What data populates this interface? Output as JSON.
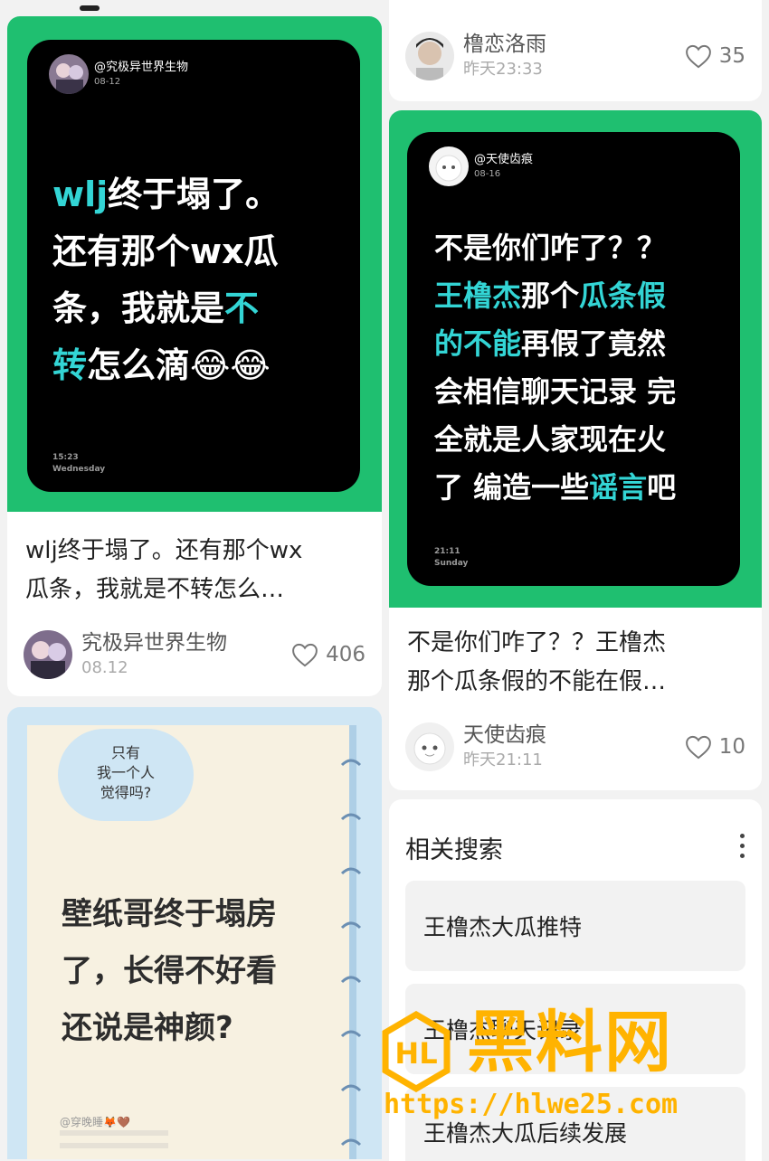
{
  "colors": {
    "green": "#1fbf70",
    "cyan": "#33d5d5",
    "watermark": "#ffb300"
  },
  "left_post_1": {
    "image": {
      "handle": "@究极异世界生物",
      "date": "08-12",
      "line1_cyan": "wlj",
      "line1": "终于塌了。",
      "line2": "还有那个wx瓜",
      "line3": "条，我就是",
      "line3_cyan": "不",
      "line4_cyan": "转",
      "line4": "怎么滴😂😂",
      "time": "15:23",
      "weekday": "Wednesday"
    },
    "title_line1": "wlj终于塌了。还有那个wx",
    "title_line2": "瓜条，我就是不转怎么…",
    "author": "究极异世界生物",
    "date": "08.12",
    "likes": "406"
  },
  "left_post_2": {
    "bubble_line1": "只有",
    "bubble_line2": "我一个人",
    "bubble_line3": "觉得吗?",
    "line1": "壁纸哥终于塌房",
    "line2": "了，长得不好看",
    "line3": "还说是神颜?",
    "footer_handle": "@穿晚睡🦊🤎"
  },
  "right_post_1": {
    "author": "橹恋洛雨",
    "date": "昨天23:33",
    "likes": "35"
  },
  "right_post_2": {
    "image": {
      "handle": "@天使齿痕",
      "date": "08-16",
      "line1": "不是你们咋了？？",
      "line2_cyan_a": "王橹杰",
      "line2": "那个",
      "line2_cyan_b": "瓜条假",
      "line3_cyan": "的不能",
      "line3": "再假了竟然",
      "line4": "会相信聊天记录 完",
      "line5": "全就是人家现在火",
      "line6": "了 编造一些",
      "line6_cyan": "谣言",
      "line6_end": "吧",
      "time": "21:11",
      "weekday": "Sunday"
    },
    "title_line1": "不是你们咋了？？王橹杰",
    "title_line2": "那个瓜条假的不能在假…",
    "author": "天使齿痕",
    "date": "昨天21:11",
    "likes": "10"
  },
  "related": {
    "title": "相关搜索",
    "items": [
      "王橹杰大瓜推特",
      "王橹杰聊天记录",
      "王橹杰大瓜后续发展"
    ]
  },
  "watermark": {
    "brand": "黑料网",
    "url": "https://hlwe25.com"
  }
}
